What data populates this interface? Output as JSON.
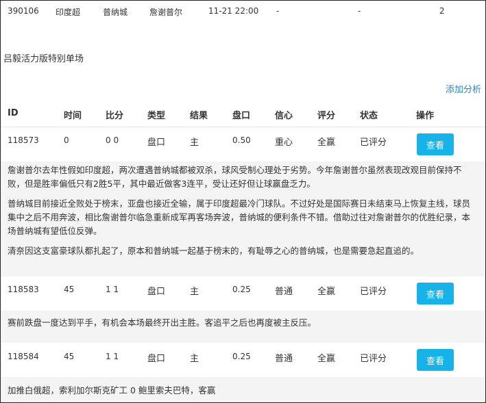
{
  "match": {
    "id": "390106",
    "league": "印度超",
    "home": "普纳城",
    "away": "詹谢普尔",
    "time": "11-21 22:00",
    "col5": "-",
    "col6": "-",
    "count": "2"
  },
  "section_title": "吕毅活力版特别单场",
  "add_analysis_label": "添加分析",
  "table": {
    "headers": [
      "ID",
      "时间",
      "比分",
      "类型",
      "结果",
      "盘口",
      "信心",
      "评分",
      "状态",
      "操作"
    ],
    "view_label": "查看",
    "rows": [
      {
        "id": "118573",
        "time": "0",
        "score": "0 0",
        "type": "盘口",
        "result": "主",
        "handicap": "0.50",
        "confidence": "重心",
        "rating": "全赢",
        "status": "已评分",
        "notes": [
          "詹谢普尔去年性假如印度超，两次遭遇普纳城都被双杀，球风受制心理处于劣势。今年詹谢普尔虽然表现改观目前保持不败，但是胜率偏低只有2胜5平，其中最近做客3连平，受让还好但让球赢盘乏力。",
          "普纳城目前接近全败处于榜末，亚盘也接近全输，属于印度超最冷门球队。不过好处是国际赛日未结束马上恢复主线，球员集中之后不用奔波，相比詹谢普尔临急重新成军再客场奔波，普纳城的便利条件不错。借助过往对詹谢普尔的优胜纪录，本场普纳城有望低位反弹。",
          "清奈因这支富豪球队都扎起了，原本和普纳城一起基于榜末的，有耻辱之心的普纳城，也是需要急起直追的。"
        ]
      },
      {
        "id": "118583",
        "time": "45",
        "score": "1 1",
        "type": "盘口",
        "result": "主",
        "handicap": "0.25",
        "confidence": "普通",
        "rating": "全赢",
        "status": "已评分",
        "notes": [
          "赛前跌盘一度达到平手，有机会本场最终开出主胜。客追平之后也再度被主反压。"
        ]
      },
      {
        "id": "118584",
        "time": "45",
        "score": "1 1",
        "type": "盘口",
        "result": "主",
        "handicap": "0.25",
        "confidence": "普通",
        "rating": "全赢",
        "status": "已评分",
        "notes": [
          "加推白俄超，索利加尔斯克矿工 0 鲍里索夫巴特，客赢"
        ]
      }
    ]
  }
}
